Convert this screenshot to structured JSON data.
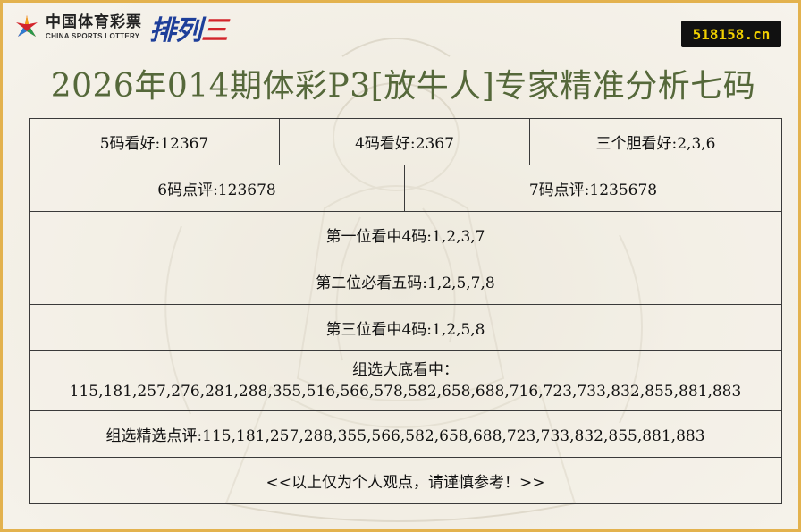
{
  "header": {
    "logo_cn": "中国体育彩票",
    "logo_en": "CHINA SPORTS LOTTERY",
    "series_part1": "排列",
    "series_part2": "三",
    "site": "518158.cn"
  },
  "title": "2026年014期体彩P3[放牛人]专家精准分析七码",
  "rows": {
    "r1": [
      "5码看好:12367",
      "4码看好:2367",
      "三个胆看好:2,3,6"
    ],
    "r2": [
      "6码点评:123678",
      "7码点评:1235678"
    ],
    "r3": "第一位看中4码:1,2,3,7",
    "r4": "第二位必看五码:1,2,5,7,8",
    "r5": "第三位看中4码:1,2,5,8",
    "r6_label": "组选大底看中：",
    "r6_values": "115,181,257,276,281,288,355,516,566,578,582,658,688,716,723,733,832,855,881,883",
    "r7": "组选精选点评:115,181,257,288,355,566,582,658,688,723,733,832,855,881,883",
    "r8": "<<以上仅为个人观点，请谨慎参考！>>"
  },
  "colors": {
    "border": "#e3b24e",
    "title": "#55683a",
    "badge_bg": "#111111",
    "badge_text": "#f0d000",
    "series_blue": "#1e3f9a",
    "series_red": "#d3242b"
  }
}
